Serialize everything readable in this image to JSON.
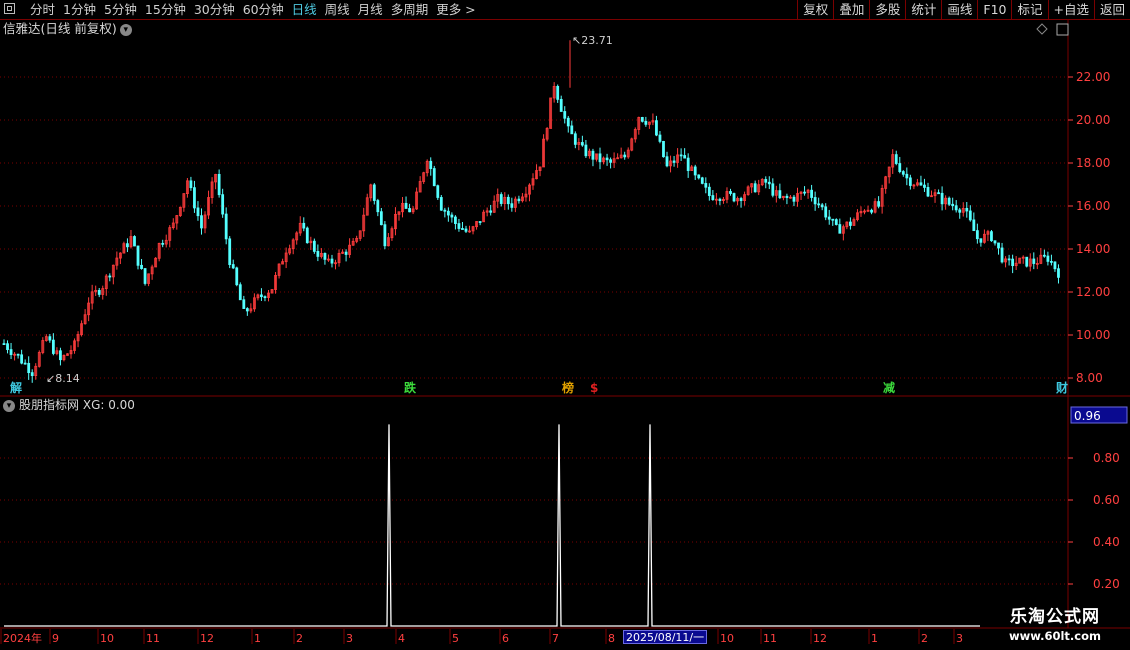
{
  "toolbar": {
    "periods": [
      "分时",
      "1分钟",
      "5分钟",
      "15分钟",
      "30分钟",
      "60分钟",
      "日线",
      "周线",
      "月线",
      "多周期",
      "更多 >"
    ],
    "active_period": "日线",
    "right_buttons": [
      "复权",
      "叠加",
      "多股",
      "统计",
      "画线",
      "F10",
      "标记",
      "+自选",
      "返回"
    ]
  },
  "main_chart": {
    "title": "信雅达(日线 前复权)",
    "high_label": "23.71",
    "low_label": "8.14",
    "y_axis_ticks": [
      "22.00",
      "20.00",
      "18.00",
      "16.00",
      "14.00",
      "12.00",
      "10.00",
      "8.00"
    ],
    "event_markers": [
      {
        "text": "解",
        "color": "#3fc8e0"
      },
      {
        "text": "跌",
        "color": "#3cdc3c"
      },
      {
        "text": "榜",
        "color": "#e0a000"
      },
      {
        "text": "$",
        "color": "#e02020"
      },
      {
        "text": "减",
        "color": "#3cdc3c"
      },
      {
        "text": "财",
        "color": "#3fc8e0"
      }
    ]
  },
  "indicator": {
    "title": "股朋指标网",
    "xg_label": "XG: 0.00",
    "y_axis_ticks": [
      "0.80",
      "0.60",
      "0.40",
      "0.20"
    ],
    "current_value": "0.96"
  },
  "time_axis": {
    "labels": [
      "2024年",
      "9",
      "10",
      "11",
      "12",
      "1",
      "2",
      "3",
      "4",
      "5",
      "6",
      "7",
      "8",
      "10",
      "11",
      "12",
      "1",
      "2",
      "3"
    ],
    "cursor_date": "2025/08/11/一"
  },
  "colors": {
    "up": "#ff3c3c",
    "down": "#54ffff",
    "grid": "#7a0000",
    "axis_text": "#ff4040"
  },
  "chart_data": {
    "type": "candlestick",
    "price_range": [
      8.14,
      23.71
    ],
    "approx_close_path": [
      9.6,
      9.0,
      8.3,
      9.9,
      8.8,
      9.5,
      11.6,
      12.3,
      13.6,
      14.5,
      12.4,
      14.2,
      15.1,
      17.2,
      15.0,
      17.5,
      13.5,
      11.0,
      11.7,
      12.2,
      14.0,
      15.0,
      14.0,
      13.3,
      13.8,
      14.3,
      17.0,
      14.4,
      15.9,
      15.8,
      18.3,
      16.0,
      15.2,
      14.7,
      15.6,
      16.3,
      16.1,
      16.8,
      18.0,
      21.7,
      19.5,
      18.6,
      18.2,
      18.0,
      18.3,
      20.2,
      19.8,
      17.8,
      18.4,
      17.3,
      16.5,
      16.5,
      16.4,
      16.8,
      17.1,
      16.3,
      16.4,
      16.7,
      15.9,
      14.9,
      15.2,
      15.9,
      16.0,
      18.3,
      17.3,
      16.9,
      16.5,
      16.1,
      15.9,
      14.5,
      14.6,
      13.3,
      13.4,
      13.4,
      13.6,
      12.7
    ],
    "signal_positions": [
      "4",
      "7",
      "2025/08/11/一"
    ],
    "indicator_signal_value": 0.96
  }
}
